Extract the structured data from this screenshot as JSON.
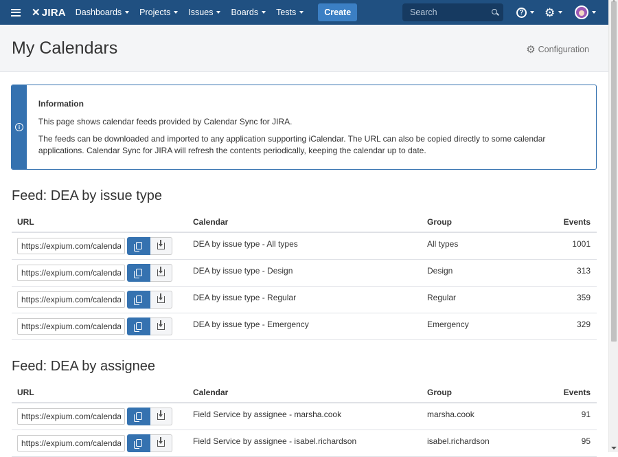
{
  "nav": {
    "logo": "JIRA",
    "items": [
      {
        "label": "Dashboards"
      },
      {
        "label": "Projects"
      },
      {
        "label": "Issues"
      },
      {
        "label": "Boards"
      },
      {
        "label": "Tests"
      }
    ],
    "create_label": "Create",
    "search_placeholder": "Search",
    "bg_color": "#205081",
    "create_color": "#3b7fc4"
  },
  "header": {
    "title": "My Calendars",
    "config_label": "Configuration"
  },
  "info": {
    "title": "Information",
    "line1": "This page shows calendar feeds provided by Calendar Sync for JIRA.",
    "line2": "The feeds can be downloaded and imported to any application supporting iCalendar. The URL can also be copied directly to some calendar applications. Calendar Sync for JIRA will refresh the contents periodically, keeping the calendar up to date.",
    "accent_color": "#3572b0"
  },
  "feeds": [
    {
      "title": "Feed: DEA by issue type",
      "columns": {
        "url": "URL",
        "calendar": "Calendar",
        "group": "Group",
        "events": "Events"
      },
      "rows": [
        {
          "url": "https://expium.com/calendar",
          "calendar": "DEA by issue type - All types",
          "group": "All types",
          "events": "1001"
        },
        {
          "url": "https://expium.com/calendar",
          "calendar": "DEA by issue type - Design",
          "group": "Design",
          "events": "313"
        },
        {
          "url": "https://expium.com/calendar",
          "calendar": "DEA by issue type - Regular",
          "group": "Regular",
          "events": "359"
        },
        {
          "url": "https://expium.com/calendar",
          "calendar": "DEA by issue type - Emergency",
          "group": "Emergency",
          "events": "329"
        }
      ]
    },
    {
      "title": "Feed: DEA by assignee",
      "columns": {
        "url": "URL",
        "calendar": "Calendar",
        "group": "Group",
        "events": "Events"
      },
      "rows": [
        {
          "url": "https://expium.com/calendar",
          "calendar": "Field Service by assignee - marsha.cook",
          "group": "marsha.cook",
          "events": "91"
        },
        {
          "url": "https://expium.com/calendar",
          "calendar": "Field Service by assignee - isabel.richardson",
          "group": "isabel.richardson",
          "events": "95"
        }
      ]
    }
  ]
}
